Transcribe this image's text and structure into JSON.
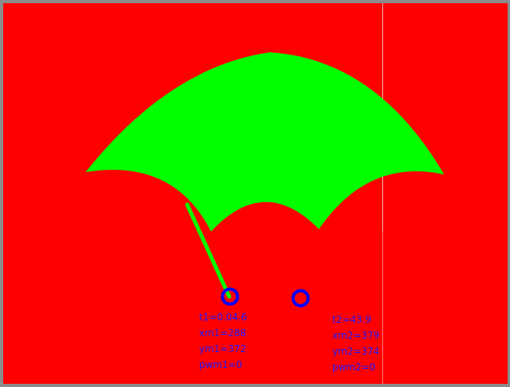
{
  "window": {
    "background_color": "#ff0000",
    "shape_color": "#00ff00",
    "marker_color": "#0000ff",
    "divider_color": "#ffb0b0"
  },
  "markers": {
    "left": "blue-ring-marker",
    "right": "blue-ring-marker"
  },
  "readout_left": {
    "t1": "t1=0.04.6",
    "xm1": "xm1=288",
    "ym1": "ym1=372",
    "pwm1": "pwm1=0"
  },
  "readout_right": {
    "t2": "t2=43.9",
    "xm2": "xm2=379",
    "ym2": "ym2=374",
    "pwm2": "pwm2=0"
  }
}
